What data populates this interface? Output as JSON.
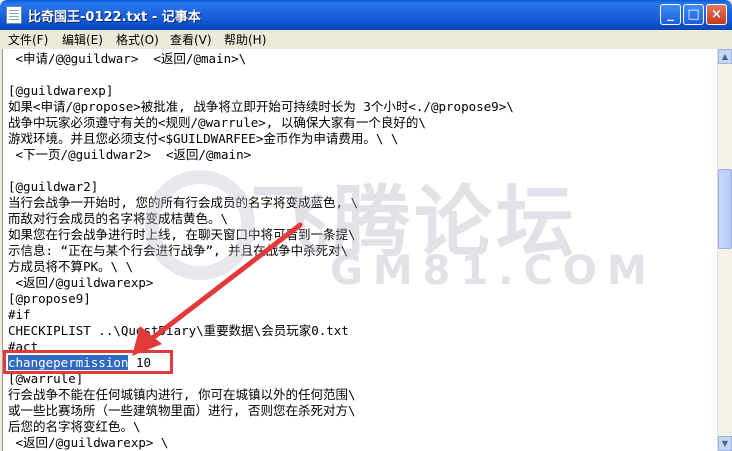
{
  "window": {
    "title": "比奇国王-0122.txt - 记事本",
    "minimize_glyph": "_",
    "maximize_glyph": "□",
    "close_glyph": "×"
  },
  "menu": [
    {
      "label": "文件(F)"
    },
    {
      "label": "编辑(E)"
    },
    {
      "label": "格式(O)"
    },
    {
      "label": "查看(V)"
    },
    {
      "label": "帮助(H)"
    }
  ],
  "editor": {
    "lines": [
      " <申请/@@guildwar>  <返回/@main>\\",
      "",
      "[@guildwarexp]",
      "如果<申请/@propose>被批准, 战争将立即开始可持续时长为 3个小时<./@propose9>\\",
      "战争中玩家必须遵守有关的<规则/@warrule>, 以确保大家有一个良好的\\",
      "游戏环境。并且您必须支付<$GUILDWARFEE>金币作为申请费用。\\ \\",
      " <下一页/@guildwar2>  <返回/@main>",
      "",
      "[@guildwar2]",
      "当行会战争一开始时, 您的所有行会成员的名字将变成蓝色, \\",
      "而敌对行会成员的名字将变成桔黄色。\\",
      "如果您在行会战争进行时上线, 在聊天窗口中将可看到一条提\\",
      "示信息: “正在与某个行会进行战争”, 并且在战争中杀死对\\",
      "方成员将不算PK。\\ \\",
      " <返回/@guildwarexp>",
      "[@propose9]",
      "#if",
      "CHECKIPLIST ..\\QuestDiary\\重要数据\\会员玩家0.txt",
      "#act",
      "",
      "[@warrule]",
      "行会战争不能在任何城镇内进行, 你可在城镇以外的任何范围\\",
      "或一些比赛场所（一些建筑物里面）进行, 否则您在杀死对方\\",
      "后您的名字将变红色。\\",
      " <返回/@guildwarexp> \\"
    ],
    "selected_text": "changepermission",
    "selected_line_rest": " 10"
  },
  "scrollbar": {
    "up_glyph": "▲",
    "down_glyph": "▼"
  },
  "watermark": {
    "main": "飞腾论坛",
    "sub": "GM81.COM"
  },
  "annotation": {
    "box_color": "#e23a3a",
    "arrow_color": "#e23a3a"
  }
}
